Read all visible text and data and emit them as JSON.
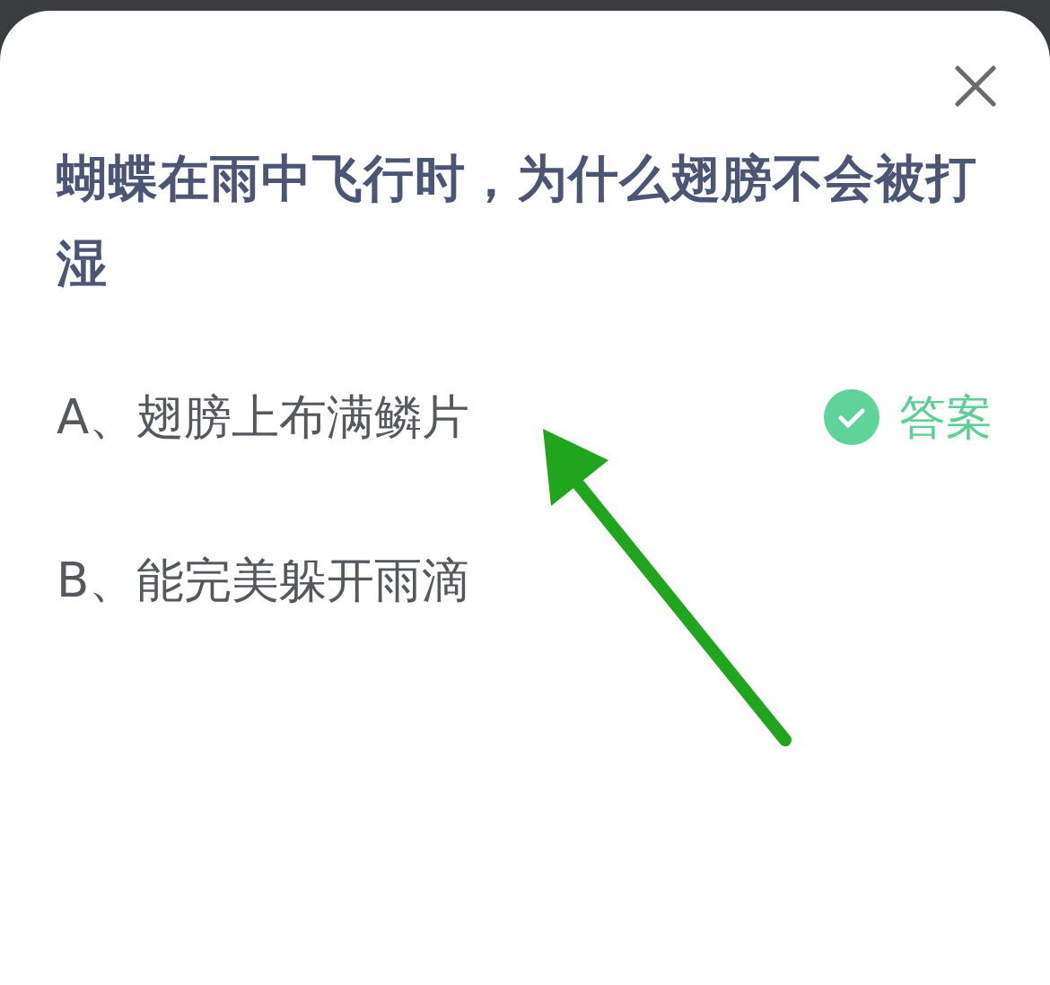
{
  "question": {
    "title": "蝴蝶在雨中飞行时，为什么翅膀不会被打湿"
  },
  "options": [
    {
      "label": "A、翅膀上布满鳞片",
      "correct": true
    },
    {
      "label": "B、能完美躲开雨滴",
      "correct": false
    }
  ],
  "answer_badge": {
    "label": "答案"
  }
}
